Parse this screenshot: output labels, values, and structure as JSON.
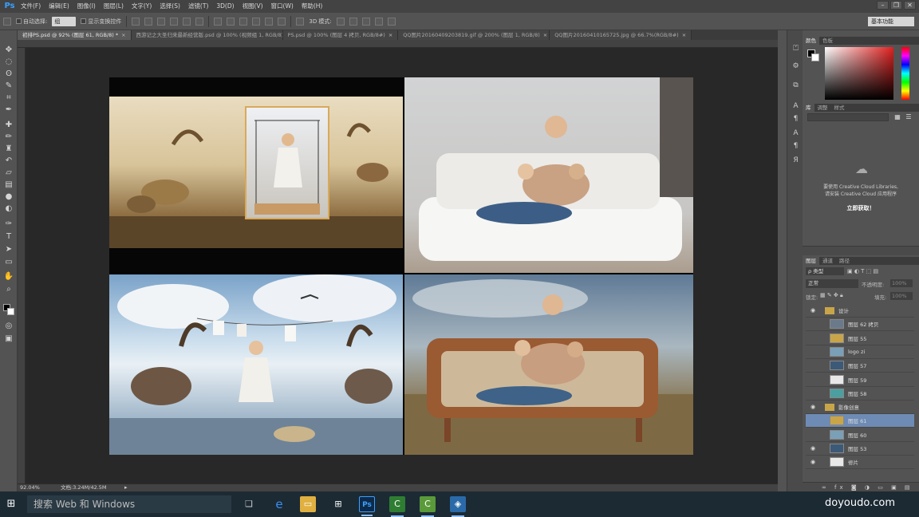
{
  "app": {
    "logo": "Ps"
  },
  "menu": [
    "文件(F)",
    "编辑(E)",
    "图像(I)",
    "图层(L)",
    "文字(Y)",
    "选择(S)",
    "滤镜(T)",
    "3D(D)",
    "视图(V)",
    "窗口(W)",
    "帮助(H)"
  ],
  "window_controls": [
    "–",
    "❐",
    "✕"
  ],
  "options_bar": {
    "auto_select_label": "自动选择:",
    "auto_select_value": "组",
    "show_transform_label": "显示变换控件",
    "mode_3d_label": "3D 模式:",
    "workspace": "基本功能"
  },
  "document_tabs": [
    {
      "title": "初排PS.psd @ 92% (图层 61, RGB/8) *",
      "active": true
    },
    {
      "title": "西游记之大圣归来最新经营版.psd @ 100% (视频组 1, RGB/8) *",
      "active": false
    },
    {
      "title": "PS.psd @ 100% (图层 4 拷贝, RGB/8#)",
      "active": false
    },
    {
      "title": "QQ图片20160409203819.gif @ 200% (图层 1, RGB/8)",
      "active": false
    },
    {
      "title": "QQ图片20160410165725.jpg @ 66.7%(RGB/8#)",
      "active": false
    }
  ],
  "status": {
    "zoom": "92.04%",
    "doc_info": "文档:3.24M/42.5M"
  },
  "color_panel": {
    "tabs": [
      "颜色",
      "色板"
    ]
  },
  "library_panel": {
    "tabs": [
      "库",
      "调整",
      "样式"
    ],
    "message_line1": "要使用 Creative Cloud Libraries,",
    "message_line2": "请安装 Creative Cloud 应用程序",
    "link": "立即获取！"
  },
  "layers_panel": {
    "tabs": [
      "图层",
      "通道",
      "路径"
    ],
    "filter": "ρ 类型",
    "blend_mode": "正常",
    "opacity_label": "不透明度:",
    "opacity_value": "100%",
    "lock_label": "锁定:",
    "fill_label": "填充:",
    "fill_value": "100%",
    "layers": [
      {
        "name": "设计",
        "type": "group",
        "visible": true,
        "selected": false
      },
      {
        "name": "图层 62 拷贝",
        "type": "layer",
        "visible": false,
        "selected": false
      },
      {
        "name": "图层 55",
        "type": "layer",
        "visible": false,
        "selected": false
      },
      {
        "name": "logo zi",
        "type": "layer",
        "visible": false,
        "selected": false
      },
      {
        "name": "图层 57",
        "type": "layer",
        "visible": false,
        "selected": false
      },
      {
        "name": "图层 59",
        "type": "layer",
        "visible": false,
        "selected": false
      },
      {
        "name": "图层 58",
        "type": "layer",
        "visible": false,
        "selected": false
      },
      {
        "name": "影像创意",
        "type": "group",
        "visible": true,
        "selected": false
      },
      {
        "name": "图层 61",
        "type": "layer",
        "visible": false,
        "selected": true
      },
      {
        "name": "图层 60",
        "type": "layer",
        "visible": false,
        "selected": false
      },
      {
        "name": "图层 53",
        "type": "layer",
        "visible": true,
        "selected": false
      },
      {
        "name": "修片",
        "type": "layer",
        "visible": true,
        "selected": false
      }
    ]
  },
  "taskbar": {
    "start_icon": "windows-logo-icon",
    "search_placeholder": "搜索 Web 和 Windows",
    "watermark": "doyoudo.com"
  }
}
